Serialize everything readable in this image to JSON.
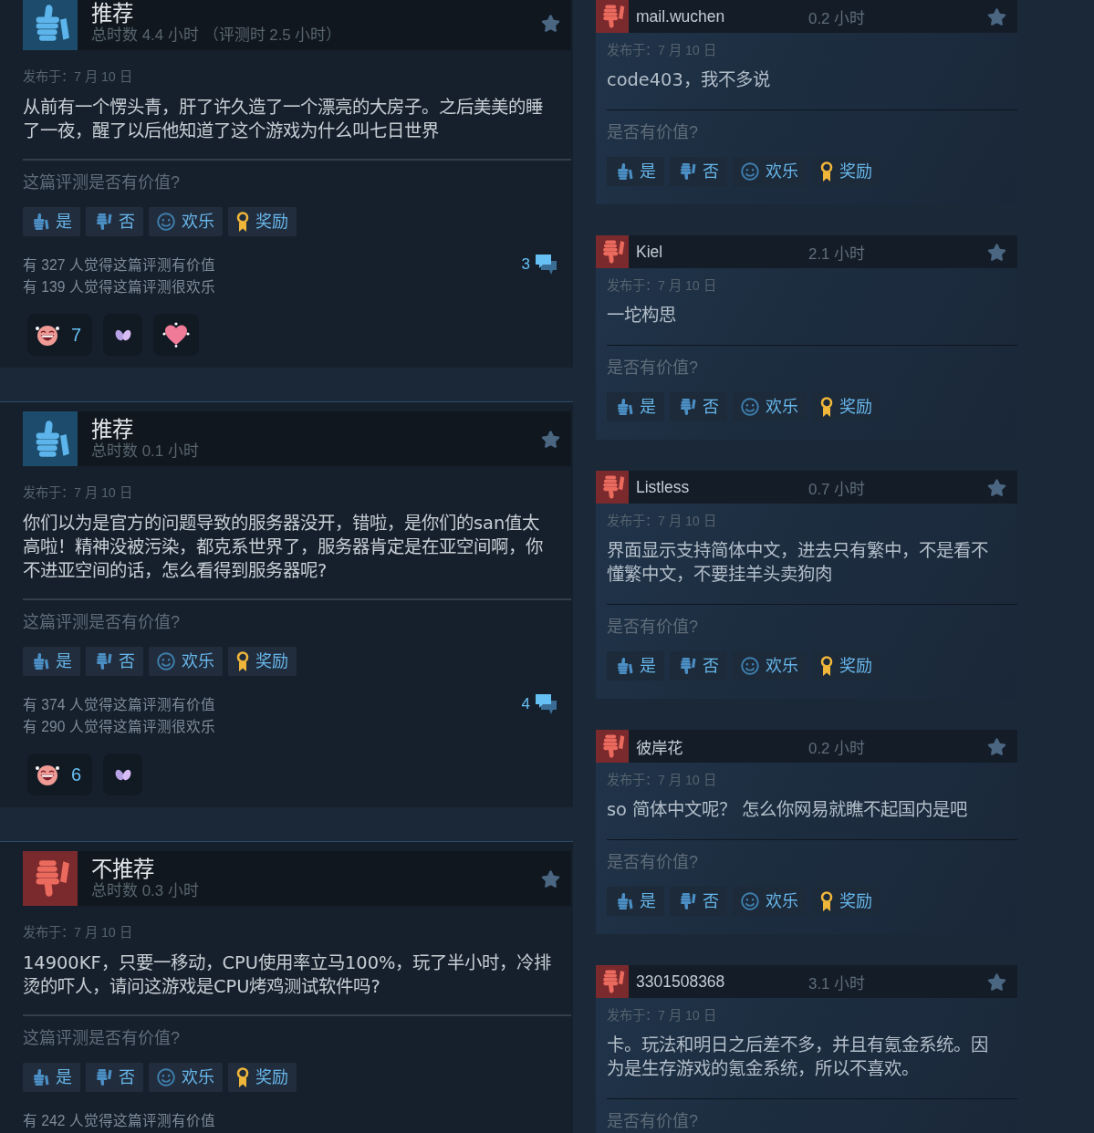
{
  "left_reviews": [
    {
      "kind": "recommended",
      "verdict": "推荐",
      "playtime": "总时数 4.4 小时 （评测时 2.5 小时）",
      "posted": "发布于：7 月 10 日",
      "body": "从前有一个愣头青，肝了许久造了一个漂亮的大房子。之后美美的睡了一夜，醒了以后他知道了这个游戏为什么叫七日世界",
      "question": "这篇评测是否有价值?",
      "buttons": [
        {
          "kind": "yes",
          "label": "是"
        },
        {
          "kind": "no",
          "label": "否"
        },
        {
          "kind": "funny",
          "label": "欢乐"
        },
        {
          "kind": "award",
          "label": "奖励"
        }
      ],
      "helpful": "有 327 人觉得这篇评测有价值",
      "funny": "有 139 人觉得这篇评测很欢乐",
      "comments": "3",
      "reactions": [
        {
          "kind": "laughing",
          "count": "7"
        },
        {
          "kind": "wings"
        },
        {
          "kind": "heart"
        }
      ]
    },
    {
      "kind": "recommended",
      "verdict": "推荐",
      "playtime": "总时数 0.1 小时",
      "posted": "发布于：7 月 10 日",
      "body": "你们以为是官方的问题导致的服务器没开，错啦，是你们的san值太高啦！精神没被污染，都克系世界了，服务器肯定是在亚空间啊，你不进亚空间的话，怎么看得到服务器呢?",
      "question": "这篇评测是否有价值?",
      "buttons": [
        {
          "kind": "yes",
          "label": "是"
        },
        {
          "kind": "no",
          "label": "否"
        },
        {
          "kind": "funny",
          "label": "欢乐"
        },
        {
          "kind": "award",
          "label": "奖励"
        }
      ],
      "helpful": "有 374 人觉得这篇评测有价值",
      "funny": "有 290 人觉得这篇评测很欢乐",
      "comments": "4",
      "reactions": [
        {
          "kind": "laughing",
          "count": "6"
        },
        {
          "kind": "wings"
        }
      ]
    },
    {
      "kind": "not_recommended",
      "verdict": "不推荐",
      "playtime": "总时数 0.3 小时",
      "posted": "发布于：7 月 10 日",
      "body": "14900KF，只要一移动，CPU使用率立马100%，玩了半小时，冷排烫的吓人，请问这游戏是CPU烤鸡测试软件吗?",
      "question": "这篇评测是否有价值?",
      "buttons": [
        {
          "kind": "yes",
          "label": "是"
        },
        {
          "kind": "no",
          "label": "否"
        },
        {
          "kind": "funny",
          "label": "欢乐"
        },
        {
          "kind": "award",
          "label": "奖励"
        }
      ],
      "helpful": "有 242 人觉得这篇评测有价值"
    }
  ],
  "right_reviews": [
    {
      "kind": "not_recommended",
      "name": "mail.wuchen",
      "hours": "0.2 小时",
      "posted": "发布于：7 月 10 日",
      "body": "code403，我不多说",
      "question": "是否有价值?",
      "buttons": [
        {
          "kind": "yes",
          "label": "是"
        },
        {
          "kind": "no",
          "label": "否"
        },
        {
          "kind": "funny",
          "label": "欢乐"
        },
        {
          "kind": "award",
          "label": "奖励"
        }
      ]
    },
    {
      "kind": "not_recommended",
      "name": "Kiel",
      "hours": "2.1 小时",
      "posted": "发布于：7 月 10 日",
      "body": "一坨构思",
      "question": "是否有价值?",
      "buttons": [
        {
          "kind": "yes",
          "label": "是"
        },
        {
          "kind": "no",
          "label": "否"
        },
        {
          "kind": "funny",
          "label": "欢乐"
        },
        {
          "kind": "award",
          "label": "奖励"
        }
      ]
    },
    {
      "kind": "not_recommended",
      "name": "Listless",
      "hours": "0.7 小时",
      "posted": "发布于：7 月 10 日",
      "body": "界面显示支持简体中文，进去只有繁中，不是看不懂繁中文，不要挂羊头卖狗肉",
      "question": "是否有价值?",
      "buttons": [
        {
          "kind": "yes",
          "label": "是"
        },
        {
          "kind": "no",
          "label": "否"
        },
        {
          "kind": "funny",
          "label": "欢乐"
        },
        {
          "kind": "award",
          "label": "奖励"
        }
      ]
    },
    {
      "kind": "not_recommended",
      "name": "彼岸花",
      "hours": "0.2 小时",
      "posted": "发布于：7 月 10 日",
      "body": "so 简体中文呢？ 怎么你网易就瞧不起国内是吧",
      "question": "是否有价值?",
      "buttons": [
        {
          "kind": "yes",
          "label": "是"
        },
        {
          "kind": "no",
          "label": "否"
        },
        {
          "kind": "funny",
          "label": "欢乐"
        },
        {
          "kind": "award",
          "label": "奖励"
        }
      ]
    },
    {
      "kind": "not_recommended",
      "name": "3301508368",
      "hours": "3.1 小时",
      "posted": "发布于：7 月 10 日",
      "body": "卡。玩法和明日之后差不多，并且有氪金系统。因为是生存游戏的氪金系统，所以不喜欢。",
      "question": "是否有价值?"
    }
  ]
}
